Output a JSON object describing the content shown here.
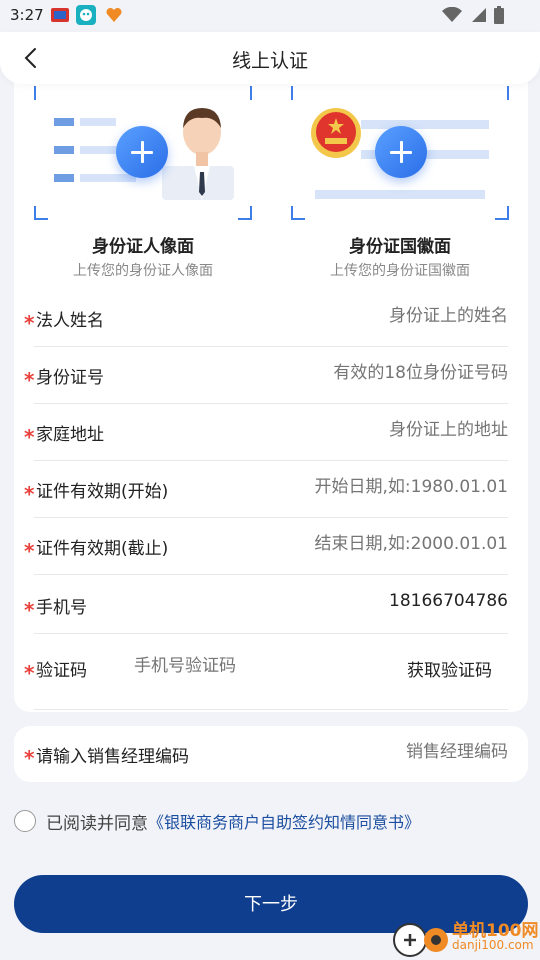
{
  "status_bar": {
    "time": "3:27"
  },
  "nav": {
    "title": "线上认证"
  },
  "uploads": [
    {
      "title": "身份证人像面",
      "subtitle": "上传您的身份证人像面"
    },
    {
      "title": "身份证国徽面",
      "subtitle": "上传您的身份证国徽面"
    }
  ],
  "form": {
    "required_mark": "*",
    "rows": [
      {
        "label": "法人姓名",
        "placeholder": "身份证上的姓名"
      },
      {
        "label": "身份证号",
        "placeholder": "有效的18位身份证号码"
      },
      {
        "label": "家庭地址",
        "placeholder": "身份证上的地址"
      },
      {
        "label": "证件有效期(开始)",
        "placeholder": "开始日期,如:1980.01.01"
      },
      {
        "label": "证件有效期(截止)",
        "placeholder": "结束日期,如:2000.01.01"
      },
      {
        "label": "手机号",
        "value": "18166704786"
      },
      {
        "label": "验证码",
        "placeholder": "手机号验证码",
        "action": "获取验证码"
      }
    ]
  },
  "manager": {
    "label": "请输入销售经理编码",
    "placeholder": "销售经理编码"
  },
  "agreement": {
    "text": "已阅读并同意",
    "link": "《银联商务商户自助签约知情同意书》"
  },
  "next_button": "下一步",
  "watermark": {
    "name": "单机100网",
    "url": "danji100.com"
  },
  "colors": {
    "accent": "#0f3e8f",
    "plus_blue": "#2a6ee8",
    "required": "#e9413b"
  }
}
